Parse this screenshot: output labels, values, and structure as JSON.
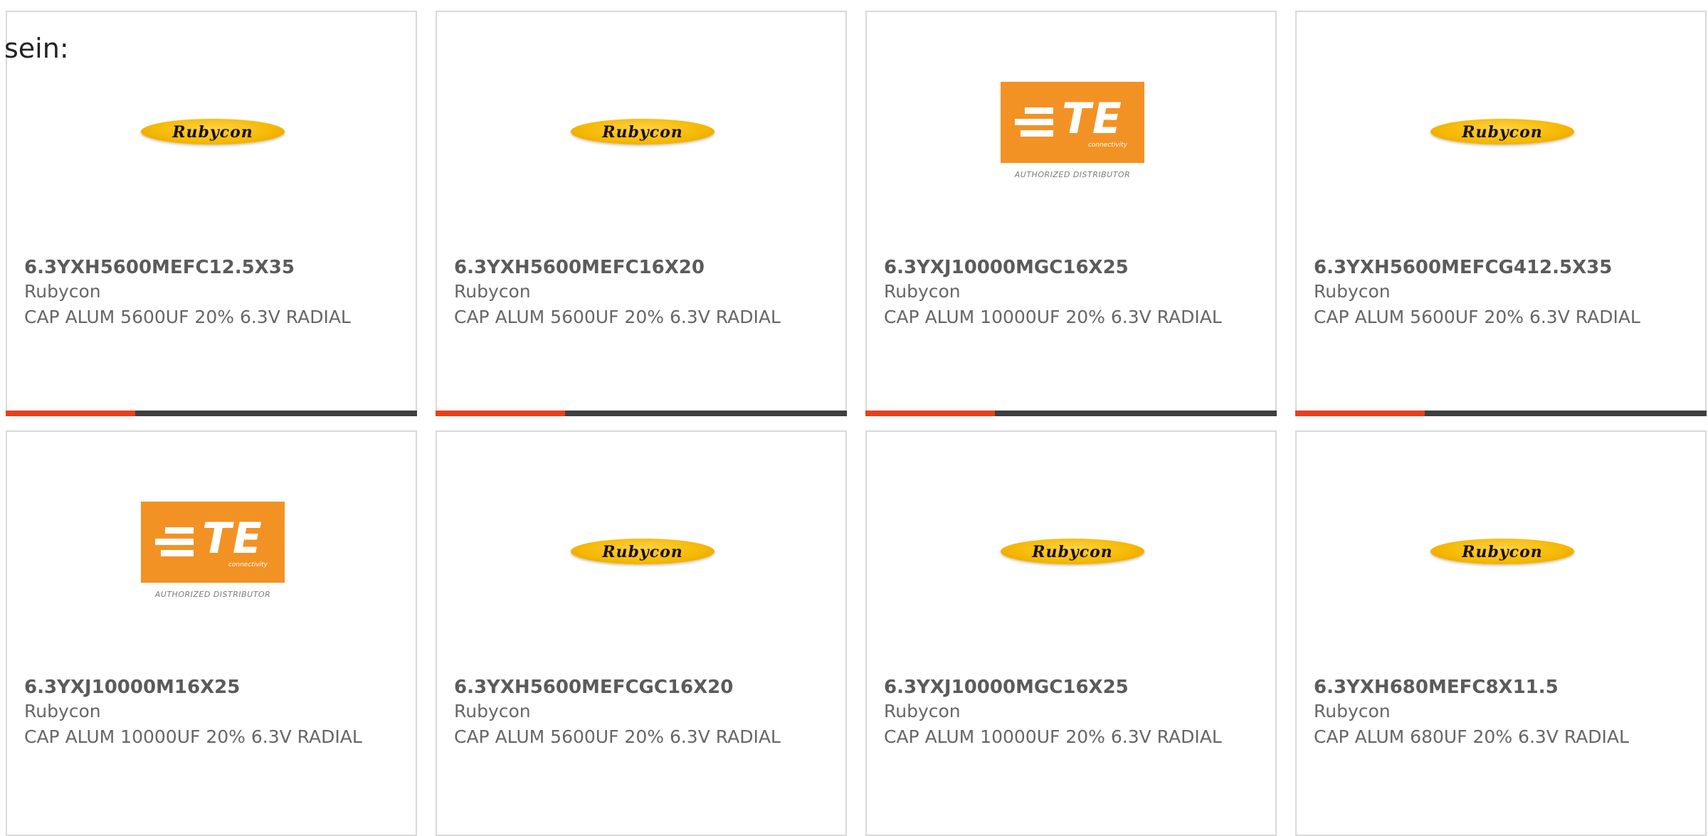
{
  "intro": "sein:",
  "colors": {
    "accent": "#e8401c",
    "bar": "#3f3f3f",
    "rubycon_yellow": "#f5b800",
    "te_orange": "#f39224"
  },
  "cards": [
    {
      "logo": "Rubycon",
      "logo_type": "rubycon",
      "part_number": "6.3YXH5600MEFC12.5X35",
      "manufacturer": "Rubycon",
      "description": "CAP ALUM 5600UF 20% 6.3V RADIAL"
    },
    {
      "logo": "Rubycon",
      "logo_type": "rubycon",
      "part_number": "6.3YXH5600MEFC16X20",
      "manufacturer": "Rubycon",
      "description": "CAP ALUM 5600UF 20% 6.3V RADIAL"
    },
    {
      "logo": "TE",
      "logo_type": "te",
      "logo_sub": "connectivity",
      "logo_caption": "AUTHORIZED DISTRIBUTOR",
      "part_number": "6.3YXJ10000MGC16X25",
      "manufacturer": "Rubycon",
      "description": "CAP ALUM 10000UF 20% 6.3V RADIAL"
    },
    {
      "logo": "Rubycon",
      "logo_type": "rubycon",
      "part_number": "6.3YXH5600MEFCG412.5X35",
      "manufacturer": "Rubycon",
      "description": "CAP ALUM 5600UF 20% 6.3V RADIAL"
    },
    {
      "logo": "TE",
      "logo_type": "te",
      "logo_sub": "connectivity",
      "logo_caption": "AUTHORIZED DISTRIBUTOR",
      "part_number": "6.3YXJ10000M16X25",
      "manufacturer": "Rubycon",
      "description": "CAP ALUM 10000UF 20% 6.3V RADIAL"
    },
    {
      "logo": "Rubycon",
      "logo_type": "rubycon",
      "part_number": "6.3YXH5600MEFCGC16X20",
      "manufacturer": "Rubycon",
      "description": "CAP ALUM 5600UF 20% 6.3V RADIAL"
    },
    {
      "logo": "Rubycon",
      "logo_type": "rubycon",
      "part_number": "6.3YXJ10000MGC16X25",
      "manufacturer": "Rubycon",
      "description": "CAP ALUM 10000UF 20% 6.3V RADIAL"
    },
    {
      "logo": "Rubycon",
      "logo_type": "rubycon",
      "part_number": "6.3YXH680MEFC8X11.5",
      "manufacturer": "Rubycon",
      "description": "CAP ALUM 680UF 20% 6.3V RADIAL"
    }
  ]
}
